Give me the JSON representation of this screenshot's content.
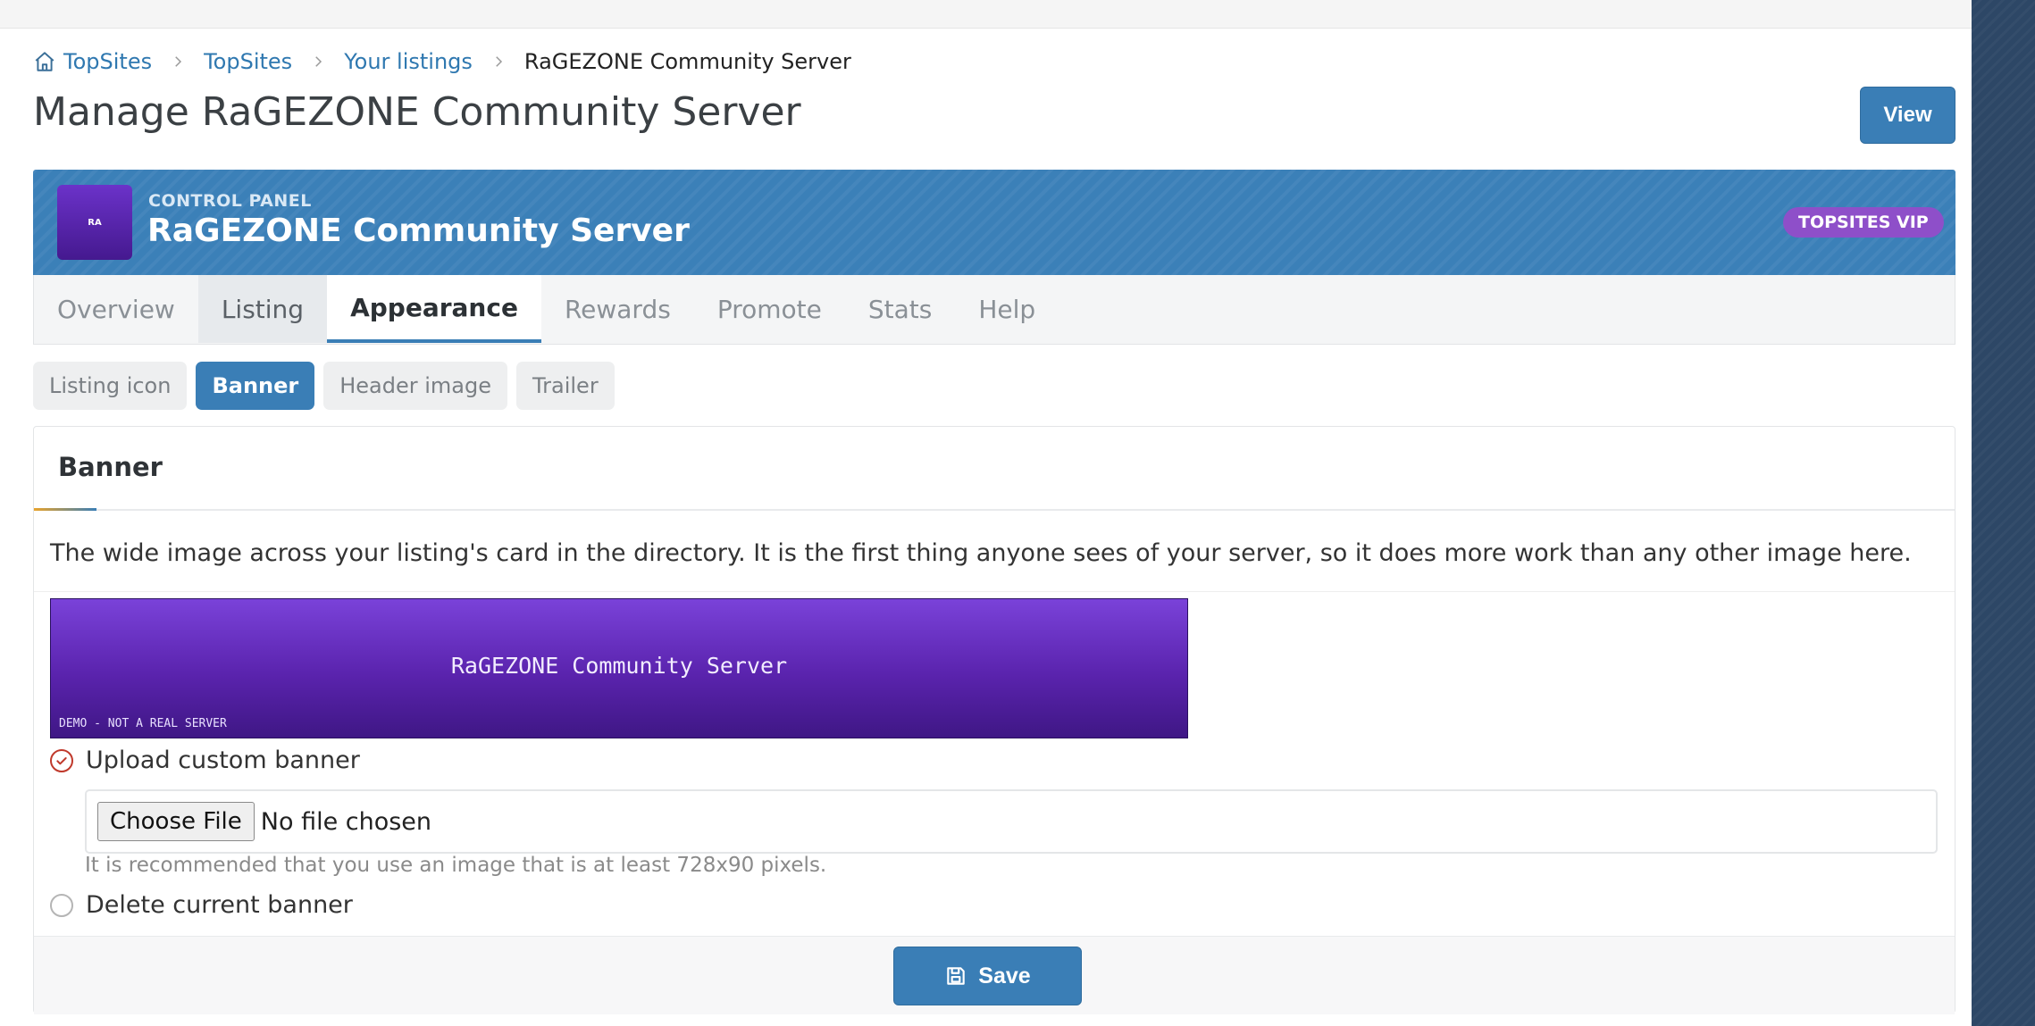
{
  "breadcrumb": {
    "items": [
      "TopSites",
      "TopSites",
      "Your listings"
    ],
    "current": "RaGEZONE Community Server"
  },
  "page": {
    "title": "Manage RaGEZONE Community Server",
    "view_label": "View"
  },
  "control_panel": {
    "avatar_initials": "RA",
    "kicker": "CONTROL PANEL",
    "name": "RaGEZONE Community Server",
    "badge": "TOPSITES VIP"
  },
  "tabs": [
    {
      "label": "Overview"
    },
    {
      "label": "Listing"
    },
    {
      "label": "Appearance"
    },
    {
      "label": "Rewards"
    },
    {
      "label": "Promote"
    },
    {
      "label": "Stats"
    },
    {
      "label": "Help"
    }
  ],
  "subtabs": [
    {
      "label": "Listing icon"
    },
    {
      "label": "Banner"
    },
    {
      "label": "Header image"
    },
    {
      "label": "Trailer"
    }
  ],
  "panel": {
    "title": "Banner",
    "description": "The wide image across your listing's card in the directory. It is the first thing anyone sees of your server, so it does more work than any other image here.",
    "banner_text": "RaGEZONE Community Server",
    "banner_demo": "DEMO - NOT A REAL SERVER",
    "upload_label": "Upload custom banner",
    "file_button": "Choose File",
    "file_status": "No file chosen",
    "hint": "It is recommended that you use an image that is at least 728x90 pixels.",
    "delete_label": "Delete current banner",
    "save_label": "Save"
  },
  "colors": {
    "accent": "#3a7eb6",
    "vip": "#8e4fc9",
    "banner_top": "#7a42d9",
    "banner_bottom": "#3f1785",
    "checked_radio": "#c0392b",
    "backdrop": "#2d4766"
  }
}
